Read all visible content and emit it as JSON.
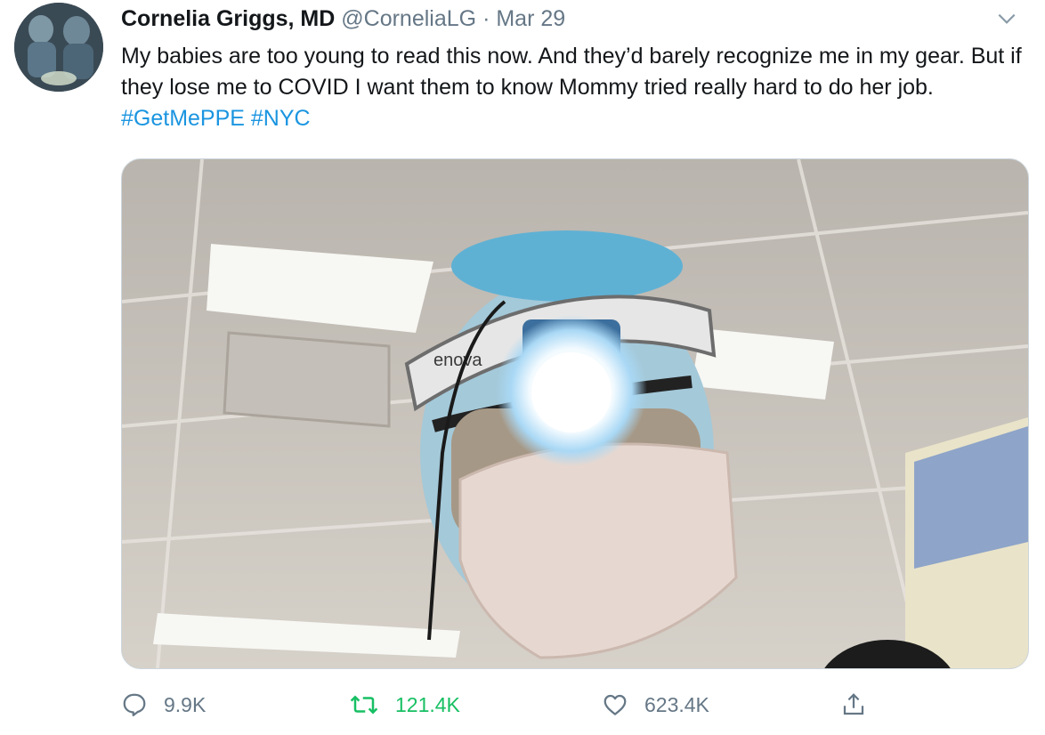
{
  "tweet": {
    "display_name": "Cornelia Griggs, MD",
    "handle": "@CorneliaLG",
    "separator": "·",
    "date": "Mar 29",
    "text_main": "My babies are too young to read this now. And they’d barely recognize me in my gear. But if they lose me to COVID I want them to know Mommy tried really hard to do her job.",
    "hashtags": [
      "#GetMePPE",
      "#NYC"
    ],
    "media_logo_text": "enova"
  },
  "actions": {
    "reply_count": "9.9K",
    "retweet_count": "121.4K",
    "like_count": "623.4K",
    "retweet_active": true
  },
  "colors": {
    "text": "#14171a",
    "secondary": "#657786",
    "link": "#1b95e0",
    "retweet_active": "#17bf63",
    "border": "#ccd6dd"
  },
  "icons": {
    "reply": "speech-bubble-icon",
    "retweet": "retweet-arrows-icon",
    "like": "heart-icon",
    "share": "share-upload-icon",
    "menu": "chevron-down-icon"
  }
}
